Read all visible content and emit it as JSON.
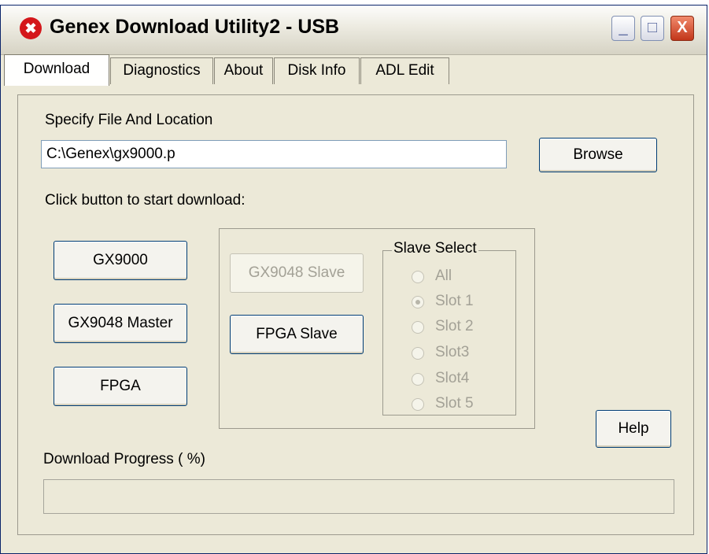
{
  "window": {
    "title": "Genex Download Utility2 - USB",
    "minimize": "_",
    "maximize": "□",
    "close": "X"
  },
  "tabs": [
    "Download",
    "Diagnostics",
    "About",
    "Disk Info",
    "ADL Edit"
  ],
  "active_tab": "Download",
  "download": {
    "file_label": "Specify File And Location",
    "file_path": "C:\\Genex\\gx9000.p",
    "browse_button": "Browse",
    "start_label": "Click button to start download:",
    "gx9000_button": "GX9000",
    "gx9048_master_button": "GX9048 Master",
    "fpga_button": "FPGA",
    "gx9048_slave_button": "GX9048 Slave",
    "fpga_slave_button": "FPGA Slave",
    "slave_select_label": "Slave Select",
    "slave_options": [
      "All",
      "Slot 1",
      "Slot 2",
      "Slot3",
      "Slot4",
      "Slot 5"
    ],
    "slave_selected": "Slot 1",
    "help_button": "Help",
    "progress_label": "Download Progress ( %)",
    "progress_value": 0
  },
  "colors": {
    "window_bg": "#ece9d8",
    "title_icon": "#d4171b",
    "close_button": "#c2361a"
  }
}
